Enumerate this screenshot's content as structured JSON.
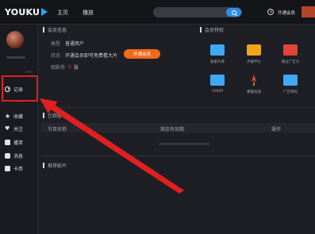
{
  "topbar": {
    "logo": "YOUKU",
    "nav": [
      "主页",
      "播放"
    ],
    "search_placeholder": "",
    "vip_label": "开通会员"
  },
  "sidebar": {
    "items": [
      {
        "label": "记录",
        "icon": "clock-icon"
      },
      {
        "label": "收藏",
        "icon": "star-icon"
      },
      {
        "label": "关注",
        "icon": "heart-icon"
      },
      {
        "label": "播单",
        "icon": "playlist-icon"
      },
      {
        "label": "消息",
        "icon": "message-icon"
      },
      {
        "label": "卡券",
        "icon": "card-icon"
      }
    ]
  },
  "member_info": {
    "title": "会员信息",
    "rows": [
      {
        "key": "类型",
        "value": "普通用户"
      },
      {
        "key": "状态",
        "value": "开通会员即可免费看大片"
      },
      {
        "key": "观影券",
        "value": "0",
        "unit": "张"
      }
    ],
    "open_button": "开通会员"
  },
  "privileges": {
    "title": "会员特权",
    "items": [
      {
        "label": "独家片库",
        "icon": "film-library-icon",
        "color": "#3fa9f5"
      },
      {
        "label": "点播半价",
        "icon": "half-price-icon",
        "color": "#f2a31b"
      },
      {
        "label": "跳过广告头",
        "icon": "skip-ad-icon",
        "color": "#e2443a"
      },
      {
        "label": "1080P",
        "icon": "hd-1080p-icon",
        "color": "#3fa9f5"
      },
      {
        "label": "專屬加速",
        "icon": "rocket-icon",
        "color": "#e2443a"
      },
      {
        "label": "广告特权",
        "icon": "ad-icon",
        "color": "#3fa9f5"
      }
    ]
  },
  "watched": {
    "title": "已观看",
    "columns": [
      "节目名称",
      "剩余有效期",
      "操作"
    ]
  },
  "recommend": {
    "title": "推荐影片"
  },
  "colors": {
    "accent": "#2a8eea",
    "orange": "#f06a1c",
    "highlight": "#e02020"
  }
}
